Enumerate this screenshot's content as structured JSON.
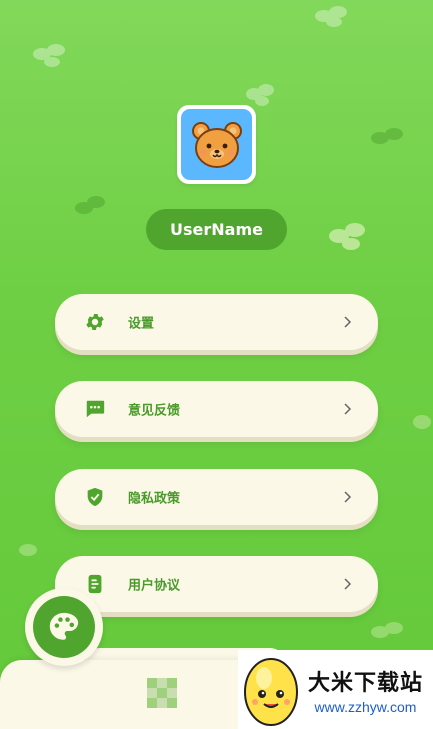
{
  "profile": {
    "username": "UserName"
  },
  "menu": {
    "items": [
      {
        "label": "设置",
        "icon": "gear-icon"
      },
      {
        "label": "意见反馈",
        "icon": "chat-bubble-icon"
      },
      {
        "label": "隐私政策",
        "icon": "shield-check-icon"
      },
      {
        "label": "用户协议",
        "icon": "document-icon"
      }
    ],
    "chevron": "›"
  },
  "bottom_nav": {
    "left_icon": "palette-icon",
    "center_icon": "qr-code-icon"
  },
  "watermark": {
    "title": "大米下载站",
    "url": "www.zzhyw.com"
  },
  "colors": {
    "background": "#6fcf44",
    "accent_green": "#4fa52e",
    "card": "#fbf8e8",
    "avatar_bg": "#5bb8ff"
  }
}
